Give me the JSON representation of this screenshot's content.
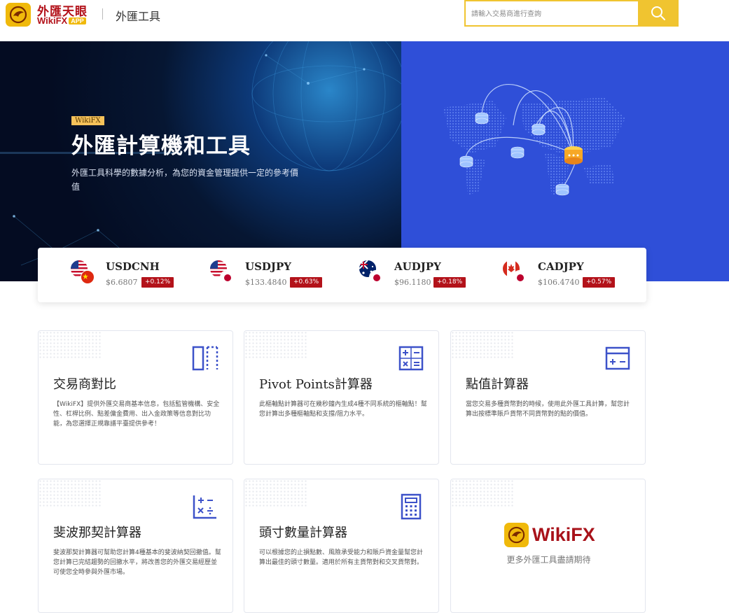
{
  "header": {
    "logo_cn": "外匯天眼",
    "logo_en": "WikiFX",
    "logo_app": "APP",
    "title": "外匯工具",
    "search_placeholder": "請輸入交易商進行查詢"
  },
  "banner": {
    "tag": "WikiFX",
    "title": "外匯計算機和工具",
    "subtitle": "外匯工具科學的數據分析，為您的資金管理提供一定的參考價值"
  },
  "quotes": [
    {
      "symbol": "USDCNH",
      "price": "$6.6807",
      "change": "+0.12%",
      "flags": [
        "us",
        "cn"
      ]
    },
    {
      "symbol": "USDJPY",
      "price": "$133.4840",
      "change": "+0.63%",
      "flags": [
        "us",
        "jp"
      ]
    },
    {
      "symbol": "AUDJPY",
      "price": "$96.1180",
      "change": "+0.18%",
      "flags": [
        "au",
        "jp"
      ]
    },
    {
      "symbol": "CADJPY",
      "price": "$106.4740",
      "change": "+0.57%",
      "flags": [
        "ca",
        "jp"
      ]
    }
  ],
  "tools": [
    {
      "title": "交易商對比",
      "icon": "compare-columns-icon",
      "desc": "【WikiFX】提供外匯交易商基本信息，包括監管機構、安全性、杠桿比例、點差傭金費用、出入金政策等信息對比功能，為您選擇正規靠譜平臺提供參考！"
    },
    {
      "title": "Pivot Points計算器",
      "icon": "pivot-calculator-icon",
      "desc": "此樞軸點計算器可在幾秒鐘內生成4種不同系統的樞軸點！幫您計算出多種樞軸點和支撐/阻力水平。"
    },
    {
      "title": "點值計算器",
      "icon": "pip-calculator-icon",
      "desc": "當您交易多種貨幣對的時候，使用此外匯工具計算，幫您計算出按標準賬戶貨幣不同貨幣對的點的價值。"
    },
    {
      "title": "斐波那契計算器",
      "icon": "fibonacci-calculator-icon",
      "desc": "斐波那契計算器可幫助您計算4種基本的斐波納契回撤值。幫您計算已完結趨勢的回撤水平，將改善您的外匯交易經歷並可使您全時參與外匯市場。"
    },
    {
      "title": "頭寸數量計算器",
      "icon": "position-calculator-icon",
      "desc": "可以根據您的止損點數、風險承受能力和賬戶資金量幫您計算出最佳的頭寸數量。適用於所有主貨幣對和交叉貨幣對。"
    }
  ],
  "more_card": {
    "brand": "WikiFX",
    "text": "更多外匯工具盡請期待"
  },
  "colors": {
    "accent_yellow": "#f0c430",
    "brand_red": "#b3121a",
    "icon_blue": "#3d52c9",
    "banner_blue": "#2f4fd8"
  }
}
